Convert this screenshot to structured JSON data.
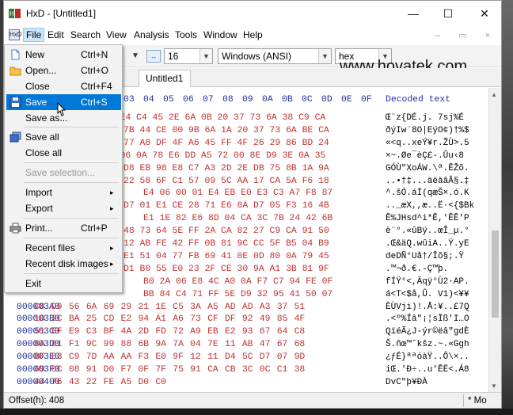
{
  "window": {
    "title": "HxD - [Untitled1]",
    "min": "—",
    "max": "☐",
    "close": "✕"
  },
  "menubar": [
    "File",
    "Edit",
    "Search",
    "View",
    "Analysis",
    "Tools",
    "Window",
    "Help"
  ],
  "menubar_icon": "HxD",
  "mdi_controls": "–  ▭  ×",
  "toolbar": {
    "bytes_per_row": "16",
    "charset": "Windows (ANSI)",
    "display": "hex"
  },
  "watermark": "www.hovatek.com",
  "tab": "Untitled1",
  "header": {
    "columns": [
      "02",
      "03",
      "04",
      "05",
      "06",
      "07",
      "08",
      "09",
      "0A",
      "0B",
      "0C",
      "0D",
      "0E",
      "0F"
    ],
    "decoded": "Decoded text"
  },
  "rows": [
    {
      "offset": "",
      "hex": "35 E4 C4 45 2E 6A 0B 20 37 73 6A 38 C9 CA",
      "dec": "Œ¨z{DÉ.j. 7sj%É"
    },
    {
      "offset": "",
      "hex": "7B 44 CE 00 9B 6A 1A 20 37 73 6A BE CA",
      "dec": "ðýIw¨8O|EýO¢)†%$"
    },
    {
      "offset": "",
      "hex": "77 A8 DF 4F A6 45 FF 4F 26 29 86 BD 24",
      "dec": "«<q..xeÝ¥r.ŽÙ>.5"
    },
    {
      "offset": "",
      "hex": "71 06 0A 78 E6 DD A5 72 00 8E D9 3E 0A 35",
      "dec": "×~.Øe¯èÇ£-.Ûu‹8"
    },
    {
      "offset": "",
      "hex": "D8 EB 98 E8 C7 A3 2D 2E DB 75 8B 1A 9A",
      "dec": "GÓÙ\"XoÁW.\\ª.ÊŽõ."
    },
    {
      "offset": "",
      "hex": "22 58 6F C1 57 09 5C AA 17 CA 5A F6 18",
      "dec": "..•†‡...äëàâÂ§.‡"
    },
    {
      "offset": "",
      "hex": "E4 06 00 01 E4 EB E0 E3 C3 A7 F8 87",
      "dec": "^.šÓ.áÍ(qæŠ×.ó.K"
    },
    {
      "offset": "",
      "hex": "D7 01 E1 CE 28 71 E6 8A D7 05 F3 16 4B",
      "dec": ".._æX,,æ..Ë·<{$Bk"
    },
    {
      "offset": "",
      "hex": "E1 1E 82 E6 8D 04 CA 3C 7B 24 42 6B",
      "dec": "Ê%JHsd^i*Ê,'ÊÊ'P"
    },
    {
      "offset": "",
      "hex": "48 73 64 5E FF 2A CA 82 27 C9 CA 91 50",
      "dec": "è¨°.«ûBÿ..œÎ_µ.°"
    },
    {
      "offset": "",
      "hex": "12 AB FE 42 FF 0B 81 9C CC 5F B5 04 B9",
      "dec": ".Œ&äQ.wûiA..Ÿ.yE"
    },
    {
      "offset": "",
      "hex": "E1 51 04 77 FB 69 41 0E 0D 80 0A 79 45",
      "dec": "deDÑ°Uå†/Îõ§;.Ÿ"
    },
    {
      "offset": "",
      "hex": "D1 B0 55 E0 23 2F CE 30 9A A1 3B 81 9F",
      "dec": ".™¬ð.€.-Ç™þ."
    },
    {
      "offset": "",
      "hex": "B0 2A 06 E8 4C A0 0A F7 C7 94 FE 0F",
      "dec": "fÍŸ°<,Äqÿ°Ù2·AP."
    },
    {
      "offset": "",
      "hex": "BB 84 C4 71 FF 5E D9 32 95 41 50 07",
      "dec": "á<T<$å,Û. V1)<¥¥"
    },
    {
      "offset": "000003A0",
      "hex": "C8 D9 56 6A 69 29 21 1E C5 3A A5 AD AD A3 37 51",
      "dec": "ÈÙVji)!.Å:¥..£7Q"
    },
    {
      "offset": "000003B0",
      "hex": "1D 3C BA 25 CD E2 94 A1 A6 73 CF DF 92 49 85 4F",
      "dec": ".<º%Íâ\"¡¦sÏß'I…O"
    },
    {
      "offset": "000003C0",
      "hex": "51 EF E9 C3 BF 4A 2D FD 72 A9 EB E2 93 67 64 C8",
      "dec": "QïéÃ¿J-ýr©ëâ\"gdÈ"
    },
    {
      "offset": "000003D0",
      "hex": "8A 81 F1 9C 99 88 6B 9A 7A 04 7E 11 AB 47 67 68",
      "dec": "Š.ñœ™ˆkšz.~.«Ggh"
    },
    {
      "offset": "000003E0",
      "hex": "BF 83 C9 7D AA AA F3 E0 9F 12 11 D4 5C D7 07 9D",
      "dec": "¿ƒÉ}ªªóàŸ..Ô\\×.."
    },
    {
      "offset": "000003F0",
      "hex": "69 8C 08 91 D0 F7 0F 7F 75 91 CA CB 3C 0C C1 38",
      "dec": "iŒ.'Ð÷..u'ÊË<.Á8"
    },
    {
      "offset": "00000400",
      "hex": "44 76 43 22 FE A5 D0 C0",
      "dec": "DvC\"þ¥ÐÀ"
    }
  ],
  "scrollbar": {
    "up": "▲",
    "down": "▼"
  },
  "status": {
    "offset": "Offset(h): 408",
    "mode": "* Mo"
  },
  "file_menu": [
    {
      "label": "New",
      "shortcut": "Ctrl+N",
      "icon": "new-file-icon"
    },
    {
      "label": "Open...",
      "shortcut": "Ctrl+O",
      "icon": "open-folder-icon"
    },
    {
      "label": "Close",
      "shortcut": "Ctrl+F4"
    },
    {
      "label": "Save",
      "shortcut": "Ctrl+S",
      "icon": "save-disk-icon"
    },
    {
      "label": "Save as..."
    },
    {
      "label": "Save all",
      "icon": "save-all-icon"
    },
    {
      "label": "Close all"
    },
    {
      "label": "Save selection..."
    },
    {
      "label": "Import",
      "submenu": "▸"
    },
    {
      "label": "Export",
      "submenu": "▸"
    },
    {
      "label": "Print...",
      "shortcut": "Ctrl+P",
      "icon": "printer-icon"
    },
    {
      "label": "Recent files",
      "submenu": "▸"
    },
    {
      "label": "Recent disk images",
      "submenu": "▸"
    },
    {
      "label": "Exit"
    }
  ],
  "colors": {
    "offset": "#1f2fa0",
    "hex": "#c03030",
    "highlight": "#0078d7"
  }
}
